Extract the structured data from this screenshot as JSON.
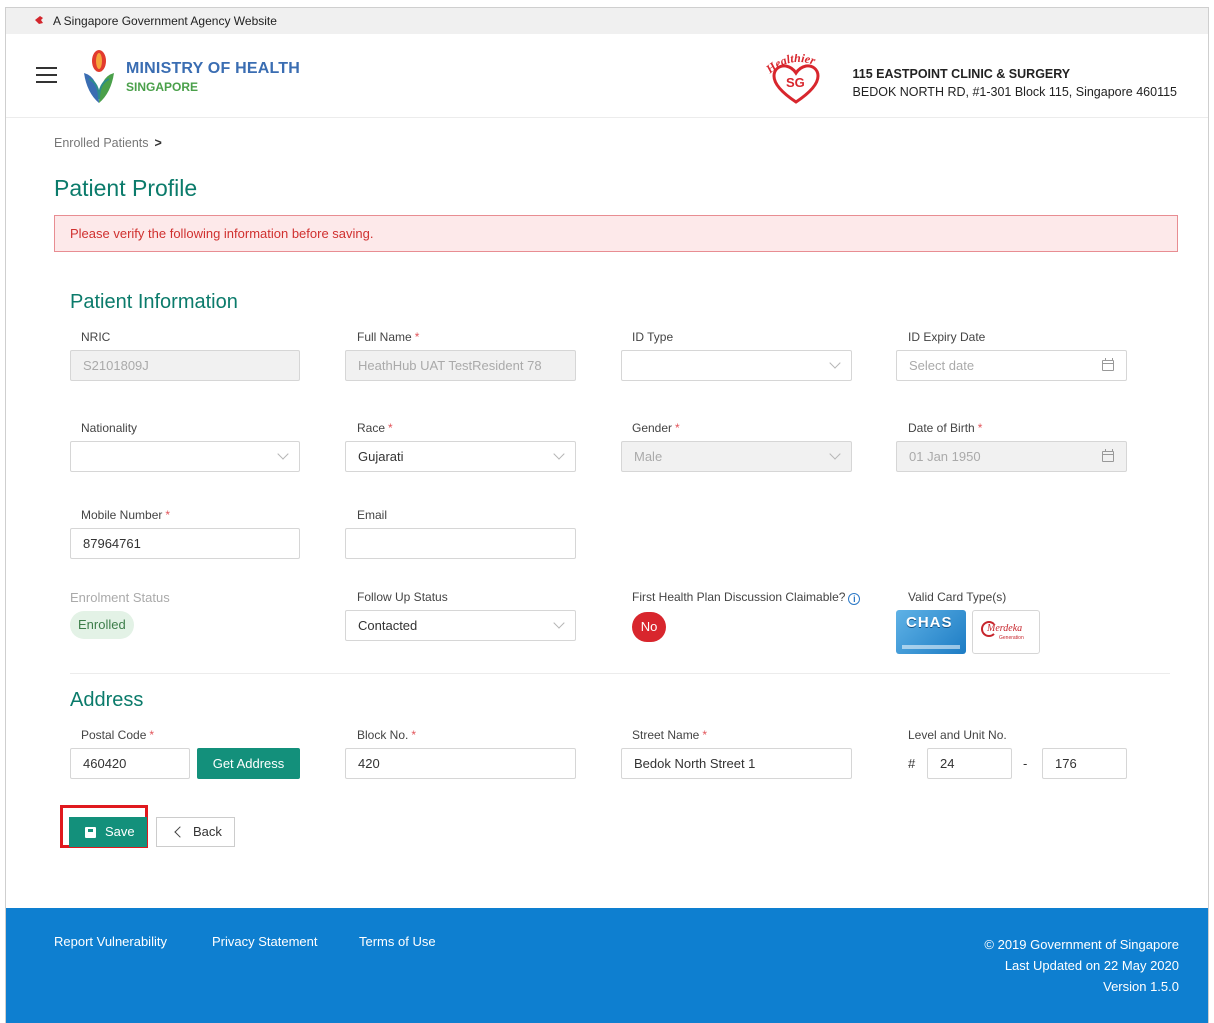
{
  "topbar": {
    "text": "A Singapore Government Agency Website"
  },
  "header": {
    "ministry_line1": "MINISTRY OF HEALTH",
    "ministry_line2": "SINGAPORE",
    "healthier_logo_text": "Healthier",
    "healthier_logo_sg": "SG",
    "clinic_name": "115 EASTPOINT CLINIC & SURGERY",
    "clinic_address": "BEDOK NORTH RD, #1-301 Block 115, Singapore 460115"
  },
  "breadcrumb": {
    "item": "Enrolled Patients",
    "separator": ">"
  },
  "page_title": "Patient Profile",
  "alert": "Please verify the following information before saving.",
  "patient_info": {
    "title": "Patient Information",
    "nric": {
      "label": "NRIC",
      "value": "S2101809J"
    },
    "full_name": {
      "label": "Full Name",
      "value": "HeathHub UAT TestResident 78"
    },
    "id_type": {
      "label": "ID Type",
      "value": ""
    },
    "id_expiry": {
      "label": "ID Expiry Date",
      "placeholder": "Select date"
    },
    "nationality": {
      "label": "Nationality",
      "value": ""
    },
    "race": {
      "label": "Race",
      "value": "Gujarati"
    },
    "gender": {
      "label": "Gender",
      "value": "Male"
    },
    "dob": {
      "label": "Date of Birth",
      "value": "01 Jan 1950"
    },
    "mobile": {
      "label": "Mobile Number",
      "value": "87964761"
    },
    "email": {
      "label": "Email",
      "value": ""
    },
    "enrolment_status": {
      "label": "Enrolment Status",
      "value": "Enrolled"
    },
    "follow_up": {
      "label": "Follow Up Status",
      "value": "Contacted"
    },
    "claimable": {
      "label": "First Health Plan Discussion Claimable?",
      "value": "No"
    },
    "cards": {
      "label": "Valid Card Type(s)",
      "chas": "CHAS",
      "merdeka": "Merdeka",
      "merdeka_sub": "Generation"
    },
    "required_mark": "*"
  },
  "address": {
    "title": "Address",
    "postal": {
      "label": "Postal Code",
      "value": "460420"
    },
    "get_address": "Get Address",
    "block": {
      "label": "Block No.",
      "value": "420"
    },
    "street": {
      "label": "Street Name",
      "value": "Bedok North Street 1"
    },
    "unit": {
      "label": "Level and Unit No.",
      "hash": "#",
      "level": "24",
      "dash": "-",
      "unit": "176"
    }
  },
  "actions": {
    "save": "Save",
    "back": "Back"
  },
  "footer": {
    "links": [
      "Report Vulnerability",
      "Privacy Statement",
      "Terms of Use"
    ],
    "copyright": "© 2019 Government of Singapore",
    "updated": "Last Updated on 22 May 2020",
    "version": "Version 1.5.0"
  },
  "colors": {
    "brand_teal": "#13907b",
    "title_teal": "#0b7b6b",
    "footer_blue": "#0e7fd0",
    "error_red": "#d8262d"
  }
}
